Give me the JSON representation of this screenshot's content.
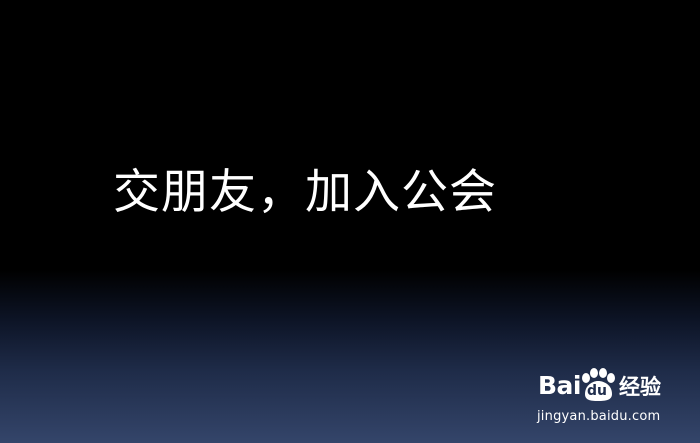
{
  "slide": {
    "headline": "交朋友，加入公会"
  },
  "watermark": {
    "brand_prefix": "Bai",
    "brand_paw_text": "du",
    "brand_suffix": "经验",
    "url": "jingyan.baidu.com",
    "logo_icon": "paw-print-icon"
  },
  "colors": {
    "background_top": "#000000",
    "background_bottom": "#34456a",
    "text": "#ffffff"
  }
}
